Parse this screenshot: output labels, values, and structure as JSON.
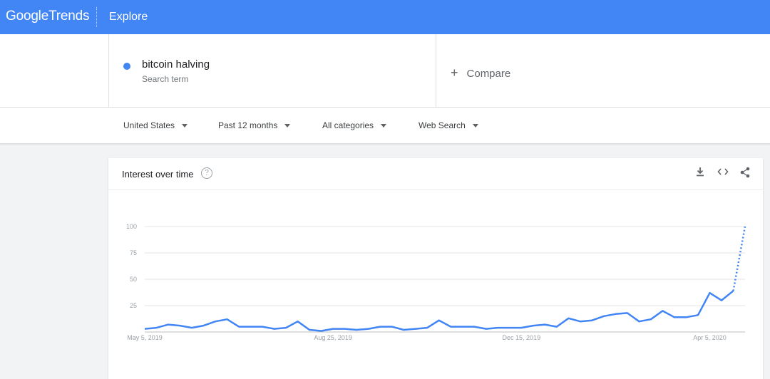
{
  "header": {
    "logo_google": "Google",
    "logo_trends": "Trends",
    "section": "Explore"
  },
  "search": {
    "term": "bitcoin halving",
    "term_sub": "Search term",
    "term_color": "#4285f4",
    "compare_label": "Compare"
  },
  "filters": {
    "region": "United States",
    "time": "Past 12 months",
    "category": "All categories",
    "property": "Web Search"
  },
  "card": {
    "title": "Interest over time",
    "icons": [
      "help-icon",
      "download-icon",
      "embed-icon",
      "share-icon"
    ]
  },
  "chart_data": {
    "type": "line",
    "series": [
      {
        "color": "#4285f4",
        "values": [
          3,
          4,
          7,
          6,
          4,
          6,
          10,
          12,
          5,
          5,
          5,
          3,
          4,
          10,
          2,
          1,
          3,
          3,
          2,
          3,
          5,
          5,
          2,
          3,
          4,
          11,
          5,
          5,
          5,
          3,
          4,
          4,
          4,
          6,
          7,
          5,
          13,
          10,
          11,
          15,
          17,
          18,
          10,
          12,
          20,
          14,
          14,
          16,
          37,
          30,
          39,
          100
        ]
      }
    ],
    "partial_from_index": 50,
    "x_ticks": [
      {
        "index": 0,
        "label": "May 5, 2019"
      },
      {
        "index": 16,
        "label": "Aug 25, 2019"
      },
      {
        "index": 32,
        "label": "Dec 15, 2019"
      },
      {
        "index": 48,
        "label": "Apr 5, 2020"
      }
    ],
    "y_ticks": [
      100,
      75,
      50,
      25
    ],
    "ylim": [
      0,
      100
    ],
    "grid": true
  }
}
